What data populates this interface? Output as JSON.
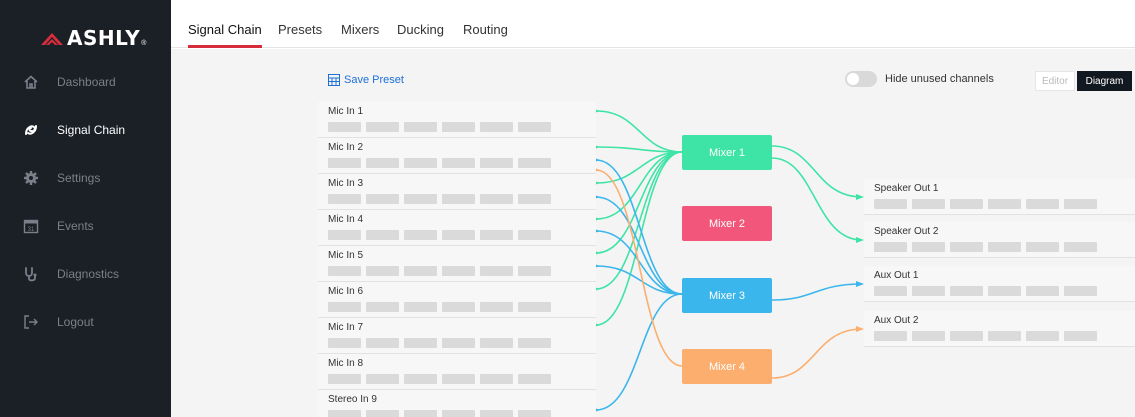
{
  "app": {
    "brand": "ASHLY",
    "brand_mark": "®"
  },
  "sidebar": {
    "items": [
      {
        "label": "Dashboard",
        "icon": "home-icon",
        "active": false
      },
      {
        "label": "Signal Chain",
        "icon": "signal-chain-icon",
        "active": true
      },
      {
        "label": "Settings",
        "icon": "gear-icon",
        "active": false
      },
      {
        "label": "Events",
        "icon": "calendar-icon",
        "active": false,
        "icon_text": "31"
      },
      {
        "label": "Diagnostics",
        "icon": "stethoscope-icon",
        "active": false
      },
      {
        "label": "Logout",
        "icon": "logout-icon",
        "active": false
      }
    ]
  },
  "tabs": [
    {
      "label": "Signal Chain",
      "active": true
    },
    {
      "label": "Presets",
      "active": false
    },
    {
      "label": "Mixers",
      "active": false
    },
    {
      "label": "Ducking",
      "active": false
    },
    {
      "label": "Routing",
      "active": false
    }
  ],
  "toolbar": {
    "save_preset": "Save Preset",
    "hide_unused": "Hide unused channels",
    "hide_unused_on": false,
    "view_editor": "Editor",
    "view_diagram": "Diagram",
    "active_view": "Diagram"
  },
  "inputs": [
    "Mic In 1",
    "Mic In 2",
    "Mic In 3",
    "Mic In 4",
    "Mic In 5",
    "Mic In 6",
    "Mic In 7",
    "Mic In 8",
    "Stereo In 9"
  ],
  "mixers": [
    {
      "label": "Mixer 1",
      "color": "#3ee4a6"
    },
    {
      "label": "Mixer 2",
      "color": "#f2567a"
    },
    {
      "label": "Mixer 3",
      "color": "#3ab6ec"
    },
    {
      "label": "Mixer 4",
      "color": "#fbae6e"
    }
  ],
  "outputs": [
    "Speaker Out 1",
    "Speaker Out 2",
    "Aux Out 1",
    "Aux Out 2"
  ],
  "colors": {
    "green": "#3ee4a6",
    "blue": "#3ab6ec",
    "orange": "#fbae6e",
    "accent_red": "#d62d3c",
    "sidebar_bg": "#1b1f26"
  }
}
